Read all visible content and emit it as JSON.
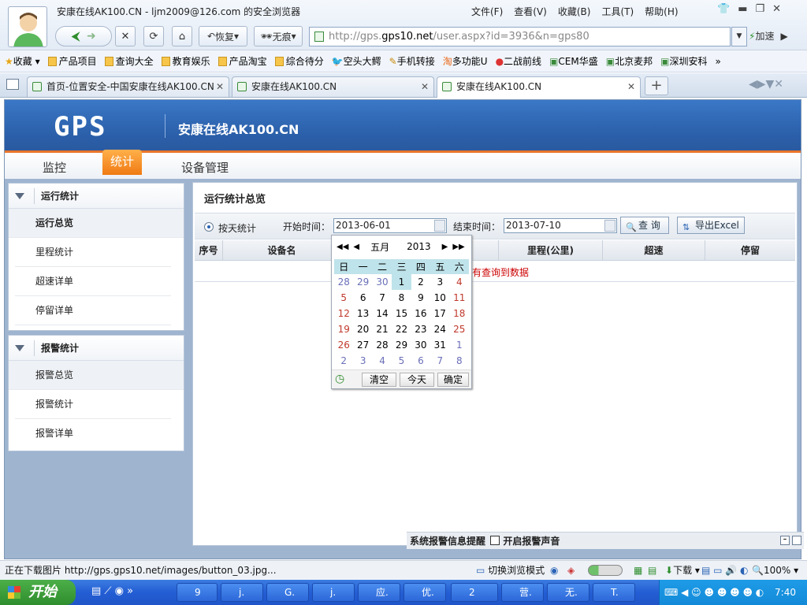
{
  "browser": {
    "window_title": "安康在线AK100.CN - ljm2009@126.com 的安全浏览器",
    "menu": [
      "文件(F)",
      "查看(V)",
      "收藏(B)",
      "工具(T)",
      "帮助(H)"
    ],
    "toolbar": {
      "restore_label": "恢复",
      "notrace_label": "无痕"
    },
    "address_prefix": "http://gps.",
    "address_domain": "gps10.net",
    "address_rest": "/user.aspx?id=3936&n=gps80",
    "speed_label": "加速",
    "favorites": [
      "收藏",
      "产品项目",
      "查询大全",
      "教育娱乐",
      "产品淘宝",
      "综合待分",
      "空头大鳄",
      "手机转接",
      "多功能U",
      "二战前线",
      "CEM华盛",
      "北京麦邦",
      "深圳安科"
    ],
    "tabs": [
      {
        "label": "首页-位置安全-中国安康在线AK100.CN"
      },
      {
        "label": "安康在线AK100.CN"
      },
      {
        "label": "安康在线AK100.CN"
      }
    ],
    "status_text": "正在下载图片 http://gps.gps10.net/images/button_03.jpg...",
    "status_mode": "切换浏览模式",
    "status_download": "下载",
    "zoom": "100%"
  },
  "site": {
    "logo": "GPS",
    "name": "安康在线AK100.CN",
    "nav": [
      "监控",
      "统计",
      "设备管理"
    ]
  },
  "sidebar": {
    "groups": [
      {
        "title": "运行统计",
        "items": [
          "运行总览",
          "里程统计",
          "超速详单",
          "停留详单"
        ]
      },
      {
        "title": "报警统计",
        "items": [
          "报警总览",
          "报警统计",
          "报警详单"
        ]
      }
    ]
  },
  "main": {
    "title": "运行统计总览",
    "daily_label": "按天统计",
    "start_label": "开始时间：",
    "start_value": "2013-06-01",
    "end_label": "结束时间：",
    "end_value": "2013-07-10",
    "query_label": "查 询",
    "export_label": "导出Excel",
    "columns": [
      "序号",
      "设备名",
      "",
      "里程(公里)",
      "超速",
      "停留"
    ],
    "nodata": "有查询到数据"
  },
  "calendar": {
    "month": "五月",
    "year": "2013",
    "weekdays": [
      "日",
      "一",
      "二",
      "三",
      "四",
      "五",
      "六"
    ],
    "rows": [
      [
        "28",
        "29",
        "30",
        "1",
        "2",
        "3",
        "4"
      ],
      [
        "5",
        "6",
        "7",
        "8",
        "9",
        "10",
        "11"
      ],
      [
        "12",
        "13",
        "14",
        "15",
        "16",
        "17",
        "18"
      ],
      [
        "19",
        "20",
        "21",
        "22",
        "23",
        "24",
        "25"
      ],
      [
        "26",
        "27",
        "28",
        "29",
        "30",
        "31",
        "1"
      ],
      [
        "2",
        "3",
        "4",
        "5",
        "6",
        "7",
        "8"
      ]
    ],
    "clear_label": "清空",
    "today_label": "今天",
    "ok_label": "确定"
  },
  "alarm": {
    "title": "系统报警信息提醒",
    "sound_label": "开启报警声音"
  },
  "taskbar": {
    "start_label": "开始",
    "buttons": [
      "9",
      "j.",
      "G.",
      "j.",
      "应.",
      "优.",
      "2",
      "营.",
      "无.",
      "T."
    ],
    "clock": "7:40"
  }
}
